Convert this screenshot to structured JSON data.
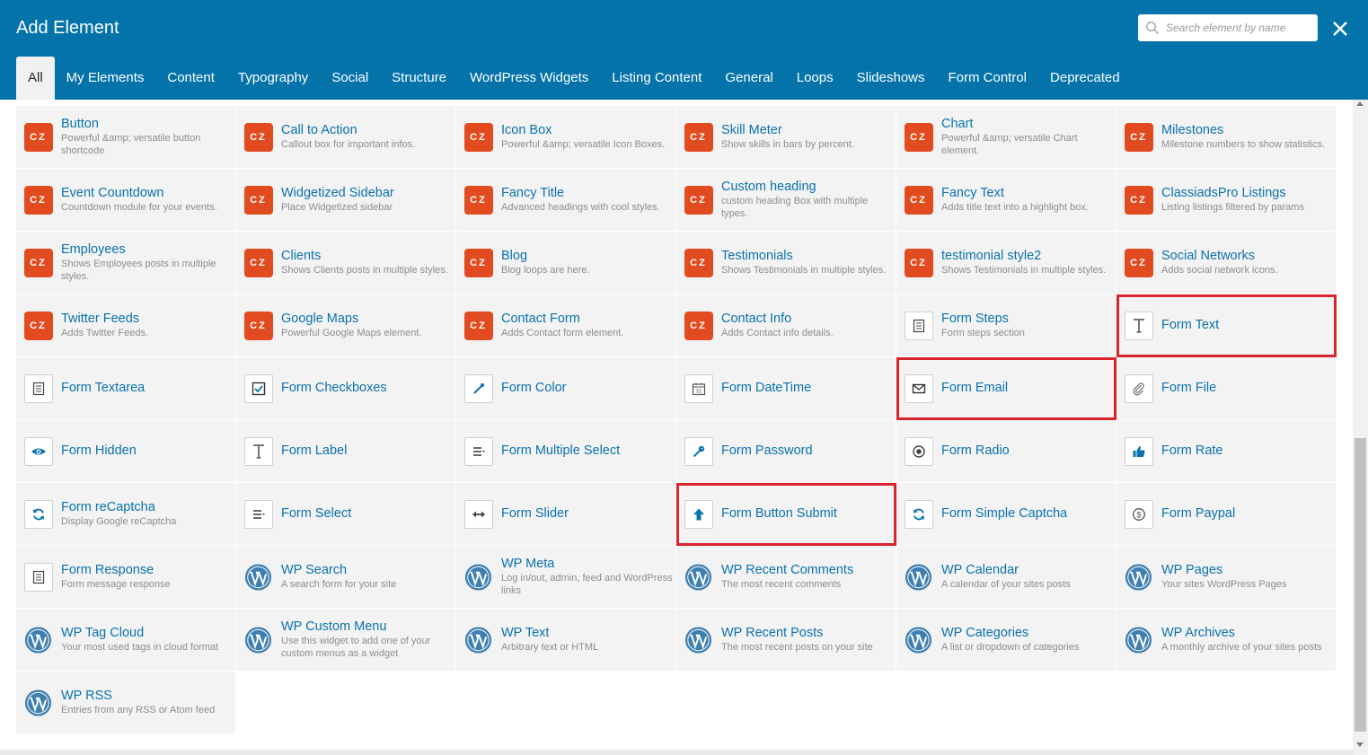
{
  "header": {
    "title": "Add Element",
    "search_placeholder": "Search element by name",
    "close_icon": "close-icon",
    "background_color": "#0473aa"
  },
  "tabs": [
    {
      "label": "All",
      "active": true
    },
    {
      "label": "My Elements"
    },
    {
      "label": "Content"
    },
    {
      "label": "Typography"
    },
    {
      "label": "Social"
    },
    {
      "label": "Structure"
    },
    {
      "label": "WordPress Widgets"
    },
    {
      "label": "Listing Content"
    },
    {
      "label": "General"
    },
    {
      "label": "Loops"
    },
    {
      "label": "Slideshows"
    },
    {
      "label": "Form Control"
    },
    {
      "label": "Deprecated"
    }
  ],
  "highlight_color": "#d9232d",
  "elements": [
    {
      "name": "Button",
      "desc": "Powerful &amp; versatile button shortcode",
      "icon": "cz"
    },
    {
      "name": "Call to Action",
      "desc": "Callout box for important infos.",
      "icon": "cz"
    },
    {
      "name": "Icon Box",
      "desc": "Powerful &amp; versatile Icon Boxes.",
      "icon": "cz"
    },
    {
      "name": "Skill Meter",
      "desc": "Show skills in bars by percent.",
      "icon": "cz"
    },
    {
      "name": "Chart",
      "desc": "Powerful &amp; versatile Chart element.",
      "icon": "cz"
    },
    {
      "name": "Milestones",
      "desc": "Milestone numbers to show statistics.",
      "icon": "cz"
    },
    {
      "name": "Event Countdown",
      "desc": "Countdown module for your events.",
      "icon": "cz"
    },
    {
      "name": "Widgetized Sidebar",
      "desc": "Place Widgetized sidebar",
      "icon": "cz"
    },
    {
      "name": "Fancy Title",
      "desc": "Advanced headings with cool styles.",
      "icon": "cz"
    },
    {
      "name": "Custom heading",
      "desc": "custom heading Box with multiple types.",
      "icon": "cz"
    },
    {
      "name": "Fancy Text",
      "desc": "Adds title text into a highlight box.",
      "icon": "cz"
    },
    {
      "name": "ClassiadsPro Listings",
      "desc": "Listing listings filtered by params",
      "icon": "cz"
    },
    {
      "name": "Employees",
      "desc": "Shows Employees posts in multiple styles.",
      "icon": "cz"
    },
    {
      "name": "Clients",
      "desc": "Shows Clients posts in multiple styles.",
      "icon": "cz"
    },
    {
      "name": "Blog",
      "desc": "Blog loops are here.",
      "icon": "cz"
    },
    {
      "name": "Testimonials",
      "desc": "Shows Testimonials in multiple styles.",
      "icon": "cz"
    },
    {
      "name": "testimonial style2",
      "desc": "Shows Testimonials in multiple styles.",
      "icon": "cz"
    },
    {
      "name": "Social Networks",
      "desc": "Adds social network icons.",
      "icon": "cz"
    },
    {
      "name": "Twitter Feeds",
      "desc": "Adds Twitter Feeds.",
      "icon": "cz"
    },
    {
      "name": "Google Maps",
      "desc": "Powerful Google Maps element.",
      "icon": "cz"
    },
    {
      "name": "Contact Form",
      "desc": "Adds Contact form element.",
      "icon": "cz"
    },
    {
      "name": "Contact Info",
      "desc": "Adds Contact info details.",
      "icon": "cz"
    },
    {
      "name": "Form Steps",
      "desc": "Form steps section",
      "icon": "form-icon"
    },
    {
      "name": "Form Text",
      "desc": "",
      "icon": "text-t-icon",
      "highlight": true
    },
    {
      "name": "Form Textarea",
      "desc": "",
      "icon": "textarea-icon"
    },
    {
      "name": "Form Checkboxes",
      "desc": "",
      "icon": "checkbox-icon"
    },
    {
      "name": "Form Color",
      "desc": "",
      "icon": "eyedropper-icon"
    },
    {
      "name": "Form DateTime",
      "desc": "",
      "icon": "calendar-icon"
    },
    {
      "name": "Form Email",
      "desc": "",
      "icon": "envelope-icon",
      "highlight": true
    },
    {
      "name": "Form File",
      "desc": "",
      "icon": "paperclip-icon"
    },
    {
      "name": "Form Hidden",
      "desc": "",
      "icon": "eye-icon"
    },
    {
      "name": "Form Label",
      "desc": "",
      "icon": "text-t-icon"
    },
    {
      "name": "Form Multiple Select",
      "desc": "",
      "icon": "multi-select-icon"
    },
    {
      "name": "Form Password",
      "desc": "",
      "icon": "key-icon"
    },
    {
      "name": "Form Radio",
      "desc": "",
      "icon": "radio-icon"
    },
    {
      "name": "Form Rate",
      "desc": "",
      "icon": "thumbs-up-icon"
    },
    {
      "name": "Form reCaptcha",
      "desc": "Display Google reCaptcha",
      "icon": "refresh-icon"
    },
    {
      "name": "Form Select",
      "desc": "",
      "icon": "select-icon"
    },
    {
      "name": "Form Slider",
      "desc": "",
      "icon": "arrows-h-icon"
    },
    {
      "name": "Form Button Submit",
      "desc": "",
      "icon": "arrow-up-icon",
      "highlight": true
    },
    {
      "name": "Form Simple Captcha",
      "desc": "",
      "icon": "refresh-icon"
    },
    {
      "name": "Form Paypal",
      "desc": "",
      "icon": "dollar-icon"
    },
    {
      "name": "Form Response",
      "desc": "Form message response",
      "icon": "form-icon"
    },
    {
      "name": "WP Search",
      "desc": "A search form for your site",
      "icon": "wordpress-icon"
    },
    {
      "name": "WP Meta",
      "desc": "Log in/out, admin, feed and WordPress links",
      "icon": "wordpress-icon"
    },
    {
      "name": "WP Recent Comments",
      "desc": "The most recent comments",
      "icon": "wordpress-icon"
    },
    {
      "name": "WP Calendar",
      "desc": "A calendar of your sites posts",
      "icon": "wordpress-icon"
    },
    {
      "name": "WP Pages",
      "desc": "Your sites WordPress Pages",
      "icon": "wordpress-icon"
    },
    {
      "name": "WP Tag Cloud",
      "desc": "Your most used tags in cloud format",
      "icon": "wordpress-icon"
    },
    {
      "name": "WP Custom Menu",
      "desc": "Use this widget to add one of your custom menus as a widget",
      "icon": "wordpress-icon"
    },
    {
      "name": "WP Text",
      "desc": "Arbitrary text or HTML",
      "icon": "wordpress-icon"
    },
    {
      "name": "WP Recent Posts",
      "desc": "The most recent posts on your site",
      "icon": "wordpress-icon"
    },
    {
      "name": "WP Categories",
      "desc": "A list or dropdown of categories",
      "icon": "wordpress-icon"
    },
    {
      "name": "WP Archives",
      "desc": "A monthly archive of your sites posts",
      "icon": "wordpress-icon"
    },
    {
      "name": "WP RSS",
      "desc": "Entries from any RSS or Atom feed",
      "icon": "wordpress-icon"
    }
  ]
}
